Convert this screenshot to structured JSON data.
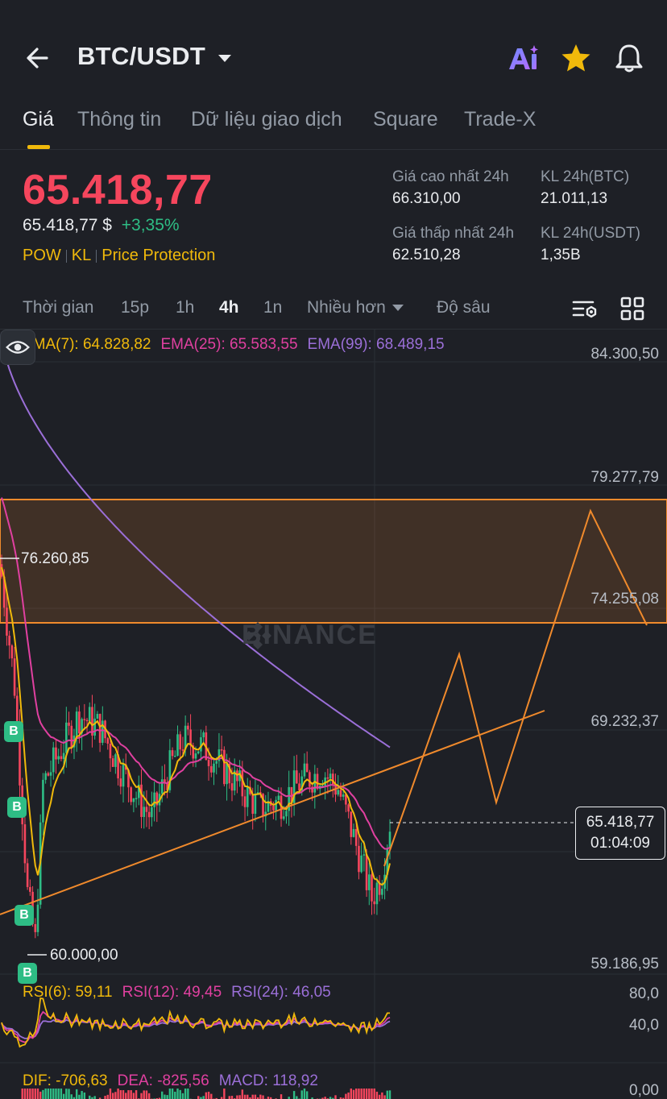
{
  "header": {
    "pair": "BTC/USDT",
    "icons": [
      "back-arrow-icon",
      "caret-down-icon",
      "ai-icon",
      "star-icon",
      "bell-icon"
    ]
  },
  "tabs": [
    {
      "label": "Giá",
      "active": true
    },
    {
      "label": "Thông tin"
    },
    {
      "label": "Dữ liệu giao dịch"
    },
    {
      "label": "Square"
    },
    {
      "label": "Trade-X"
    }
  ],
  "ticker": {
    "last_price": "65.418,77",
    "usd_price": "65.418,77 $",
    "change": "+3,35%",
    "tags": [
      "POW",
      "KL",
      "Price Protection"
    ],
    "stats": [
      {
        "label": "Giá cao nhất 24h",
        "value": "66.310,00"
      },
      {
        "label": "KL 24h(BTC)",
        "value": "21.011,13"
      },
      {
        "label": "Giá thấp nhất 24h",
        "value": "62.510,28"
      },
      {
        "label": "KL 24h(USDT)",
        "value": "1,35B"
      }
    ]
  },
  "intervals": {
    "items": [
      "Thời gian",
      "15p",
      "1h",
      "4h",
      "1n",
      "Nhiều hơn",
      "Độ sâu"
    ],
    "active": "4h"
  },
  "chart": {
    "ema": {
      "ema7": "EMA(7): 64.828,82",
      "ema25": "EMA(25): 65.583,55",
      "ema99": "EMA(99): 68.489,15"
    },
    "y_axis": [
      "84.300,50",
      "79.277,79",
      "74.255,08",
      "69.232,37",
      "59.186,95"
    ],
    "watermark": "BINANCE",
    "high_marker": "76.260,85",
    "low_marker": "60.000,00",
    "current_price": "65.418,77",
    "countdown": "01:04:09",
    "badge_label": "B",
    "rsi": {
      "rsi6": "RSI(6): 59,11",
      "rsi12": "RSI(12): 49,45",
      "rsi24": "RSI(24): 46,05",
      "axis_high": "80,0",
      "axis_low": "40,0"
    },
    "macd": {
      "dif": "DIF: -706,63",
      "dea": "DEA: -825,56",
      "macd": "MACD: 118,92",
      "axis": "0,00"
    },
    "colors": {
      "up": "#2ebd85",
      "down": "#f6465d",
      "ema7": "#f0b90b",
      "ema25": "#e040a0",
      "ema99": "#9b6fd8",
      "drawing": "#f08a2c"
    }
  }
}
